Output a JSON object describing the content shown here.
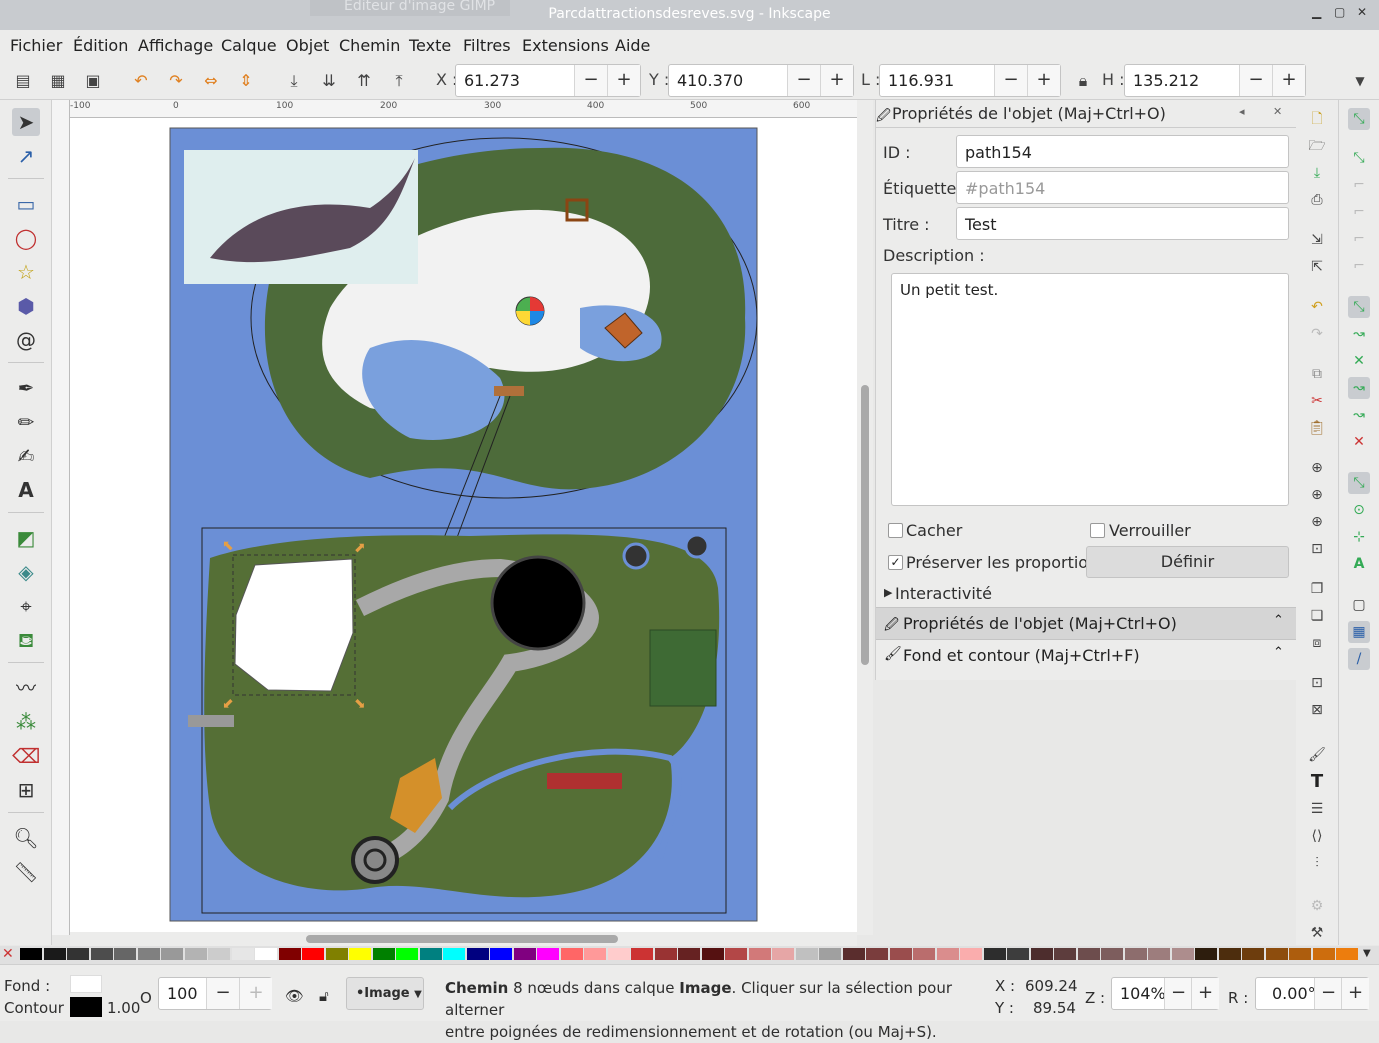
{
  "window": {
    "background_title": "Editeur d'image GIMP",
    "title": "Parcdattractionsdesreves.svg - Inkscape"
  },
  "menu": [
    "Fichier",
    "Édition",
    "Affichage",
    "Calque",
    "Objet",
    "Chemin",
    "Texte",
    "Filtres",
    "Extensions",
    "Aide"
  ],
  "toolbar": {
    "x_label": "X :",
    "x_value": "61.273",
    "y_label": "Y :",
    "y_value": "410.370",
    "w_label": "L :",
    "w_value": "116.931",
    "h_label": "H :",
    "h_value": "135.212",
    "minus": "−",
    "plus": "+"
  },
  "ruler_ticks": [
    "-100",
    "0",
    "100",
    "200",
    "300",
    "400",
    "500",
    "600"
  ],
  "panel": {
    "title": "Propriétés de l'objet (Maj+Ctrl+O)",
    "id_label": "ID :",
    "id_value": "path154",
    "label_label": "Étiquette :",
    "label_placeholder": "#path154",
    "title_label": "Titre :",
    "title_value": "Test",
    "desc_label": "Description :",
    "desc_value": "Un petit test.",
    "hide_label": "Cacher",
    "lock_label": "Verrouiller",
    "preserve_label": "Préserver les proportions",
    "define_button": "Définir",
    "interactivity": "Interactivité",
    "dock_object": "Propriétés de l'objet (Maj+Ctrl+O)",
    "dock_fill": "Fond et contour (Maj+Ctrl+F)"
  },
  "status": {
    "fill_label": "Fond :",
    "stroke_label": "Contour :",
    "stroke_width": "1.00",
    "opacity_label": "O :",
    "opacity_value": "100",
    "layer": "•Image",
    "message_bold1": "Chemin",
    "message_part1": " 8 nœuds dans calque ",
    "message_bold2": "Image",
    "message_part2": ". Cliquer sur la sélection pour alterner",
    "message_line2": "entre poignées de redimensionnement et de rotation (ou Maj+S).",
    "cx_label": "X :",
    "cx_value": "609.24",
    "cy_label": "Y :",
    "cy_value": "89.54",
    "zoom_label": "Z :",
    "zoom_value": "104%",
    "rot_label": "R :",
    "rot_value": "0.00°"
  },
  "colors": {
    "canvas_blue": "#6b8fd6",
    "selection": "#e59f45"
  },
  "palette": [
    "#000000",
    "#1a1a1a",
    "#333333",
    "#4d4d4d",
    "#666666",
    "#808080",
    "#999999",
    "#b3b3b3",
    "#cccccc",
    "#e6e6e6",
    "#ffffff",
    "#800000",
    "#ff0000",
    "#808000",
    "#ffff00",
    "#008000",
    "#00ff00",
    "#008080",
    "#00ffff",
    "#000080",
    "#0000ff",
    "#800080",
    "#ff00ff",
    "#ff6666",
    "#ff9999",
    "#ffcccc",
    "#cc3333",
    "#993333",
    "#662222",
    "#551111",
    "#b34747",
    "#d27979",
    "#e6a6a6",
    "#c0c0c0",
    "#a0a0a0",
    "#5a2d2d",
    "#7a3d3d",
    "#9a4d4d",
    "#ba6d6d",
    "#da8d8d",
    "#faadad",
    "#2d2d2d",
    "#3d3d3d",
    "#4d2d2d",
    "#5d3d3d",
    "#6d4d4d",
    "#7d5d5d",
    "#8d6d6d",
    "#9d7d7d",
    "#ad8d8d",
    "#2d1d0d",
    "#4d2d0d",
    "#6d3d0d",
    "#8d4d0d",
    "#ad5d0d",
    "#cd6d0d",
    "#ed7d0d"
  ]
}
